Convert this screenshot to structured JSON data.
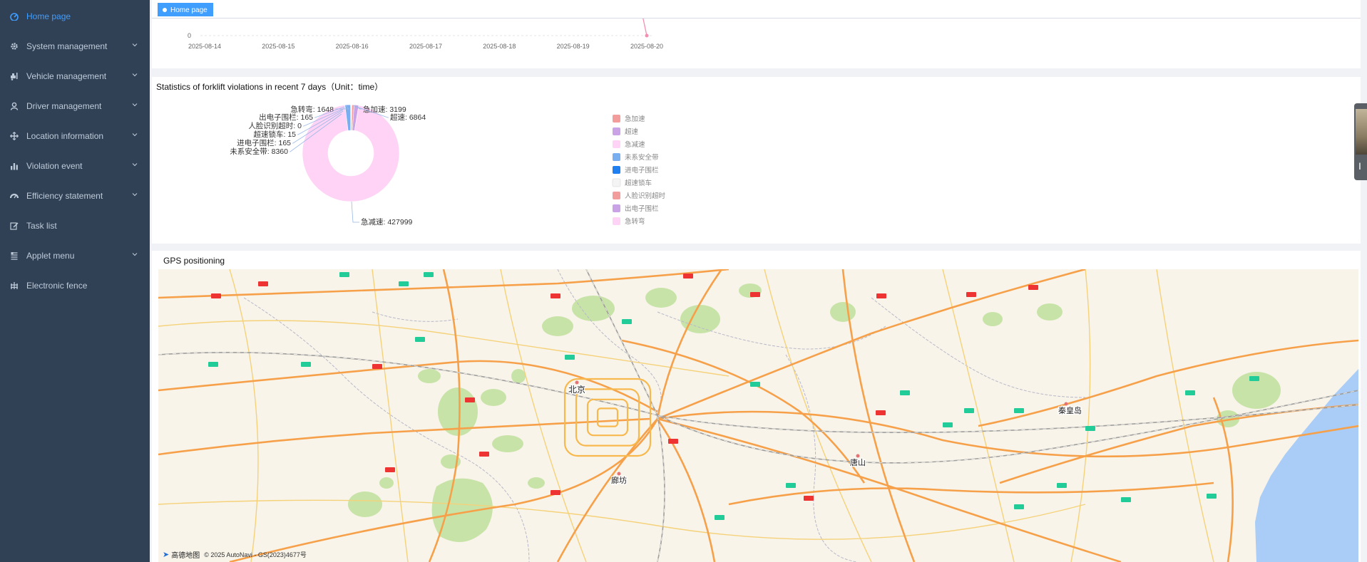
{
  "sidebar": {
    "items": [
      {
        "label": "Home page",
        "icon": "dashboard-icon",
        "active": true,
        "has_children": false
      },
      {
        "label": "System management",
        "icon": "gear-icon",
        "active": false,
        "has_children": true
      },
      {
        "label": "Vehicle management",
        "icon": "forklift-icon",
        "active": false,
        "has_children": true
      },
      {
        "label": "Driver management",
        "icon": "user-icon",
        "active": false,
        "has_children": true
      },
      {
        "label": "Location information",
        "icon": "move-icon",
        "active": false,
        "has_children": true
      },
      {
        "label": "Violation event",
        "icon": "bar-chart-icon",
        "active": false,
        "has_children": true
      },
      {
        "label": "Efficiency statement",
        "icon": "gauge-icon",
        "active": false,
        "has_children": true
      },
      {
        "label": "Task list",
        "icon": "edit-icon",
        "active": false,
        "has_children": false
      },
      {
        "label": "Applet menu",
        "icon": "list-icon",
        "active": false,
        "has_children": true
      },
      {
        "label": "Electronic fence",
        "icon": "fence-icon",
        "active": false,
        "has_children": false
      }
    ]
  },
  "tags": {
    "home_label": "Home page"
  },
  "line_chart": {
    "chart_data": {
      "type": "line",
      "x": [
        "2025-08-14",
        "2025-08-15",
        "2025-08-16",
        "2025-08-17",
        "2025-08-18",
        "2025-08-19",
        "2025-08-20"
      ],
      "y_ticks_visible": [
        "0"
      ],
      "series_color": "#f48fb1",
      "note_visible": "only bottom of chart visible; last point at 0"
    }
  },
  "pie_chart": {
    "title": "Statistics of forklift violations in recent 7 days（Unit：time）",
    "chart_data": {
      "type": "pie",
      "slices": [
        {
          "name": "急加速",
          "value": 3199,
          "color": "#f39c9c"
        },
        {
          "name": "超速",
          "value": 6864,
          "color": "#c9a3e6"
        },
        {
          "name": "急减速",
          "value": 427999,
          "color": "#ffd3f5"
        },
        {
          "name": "未系安全带",
          "value": 8360,
          "color": "#79aef0"
        },
        {
          "name": "进电子围栏",
          "value": 165,
          "color": "#1f7ef0"
        },
        {
          "name": "超速锁车",
          "value": 15,
          "color": "#f4f4f4"
        },
        {
          "name": "人脸识别超时",
          "value": 0,
          "color": "#f39c9c"
        },
        {
          "name": "出电子围栏",
          "value": 165,
          "color": "#c9a3e6"
        },
        {
          "name": "急转弯",
          "value": 1648,
          "color": "#ffd3f5"
        }
      ],
      "labels": {
        "l1": "急转弯: 1648",
        "l2": "急加速: 3199",
        "l3": "超速: 6864",
        "l4": "出电子围栏: 165",
        "l5": "人脸识别超时: 0",
        "l6": "超速锁车: 15",
        "l7": "进电子围栏: 165",
        "l8": "未系安全带: 8360",
        "l9": "急减速: 427999"
      },
      "legend_placement": "right",
      "legend": [
        "急加速",
        "超速",
        "急减速",
        "未系安全带",
        "进电子围栏",
        "超速锁车",
        "人脸识别超时",
        "出电子围栏",
        "急转弯"
      ]
    }
  },
  "gps": {
    "title": "GPS positioning",
    "map": {
      "cities": {
        "beijing": "北京",
        "langfang": "廊坊",
        "tangshan": "唐山",
        "qinhuangdao": "秦皇岛"
      },
      "attribution": "© 2025 AutoNavi - GS(2023)4677号",
      "logo_text": "高德地图"
    }
  }
}
